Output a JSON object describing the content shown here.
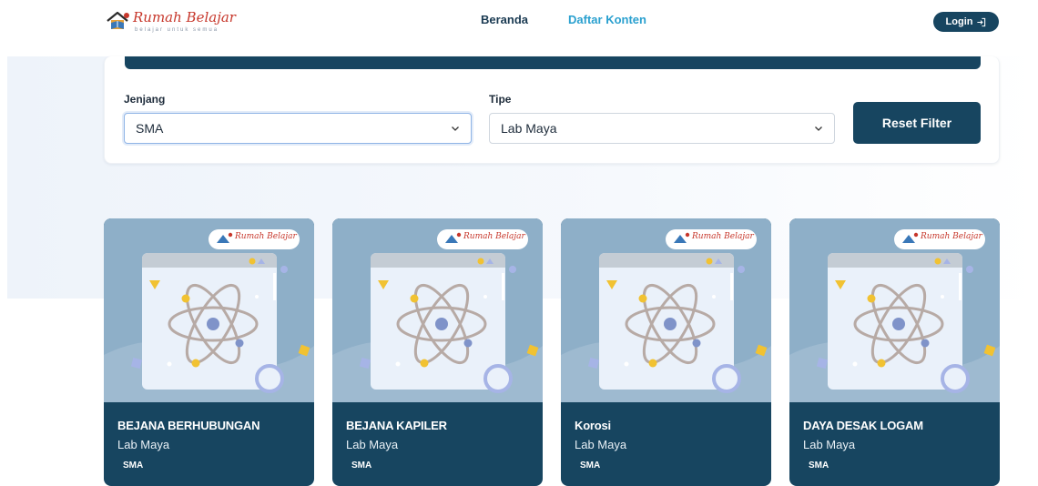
{
  "brand": {
    "title": "Rumah Belajar",
    "tagline": "belajar untuk semua",
    "mark_icon": "house-book-logo-icon"
  },
  "nav": {
    "items": [
      {
        "label": "Beranda",
        "active": false
      },
      {
        "label": "Daftar Konten",
        "active": true
      }
    ],
    "login_label": "Login",
    "login_icon": "login-arrow-icon"
  },
  "filters": {
    "jenjang": {
      "label": "Jenjang",
      "value": "SMA"
    },
    "tipe": {
      "label": "Tipe",
      "value": "Lab Maya"
    },
    "reset_label": "Reset Filter"
  },
  "cards": [
    {
      "title": "BEJANA BERHUBUNGAN",
      "type": "Lab Maya",
      "level": "SMA",
      "thumb_logo": "Rumah Belajar"
    },
    {
      "title": "BEJANA KAPILER",
      "type": "Lab Maya",
      "level": "SMA",
      "thumb_logo": "Rumah Belajar"
    },
    {
      "title": "Korosi",
      "type": "Lab Maya",
      "level": "SMA",
      "thumb_logo": "Rumah Belajar"
    },
    {
      "title": "DAYA DESAK LOGAM",
      "type": "Lab Maya",
      "level": "SMA",
      "thumb_logo": "Rumah Belajar"
    }
  ],
  "colors": {
    "primary": "#174560",
    "accent": "#2aa0cf",
    "brand_red": "#c7372b",
    "thumb_bg": "#8eafc8"
  }
}
